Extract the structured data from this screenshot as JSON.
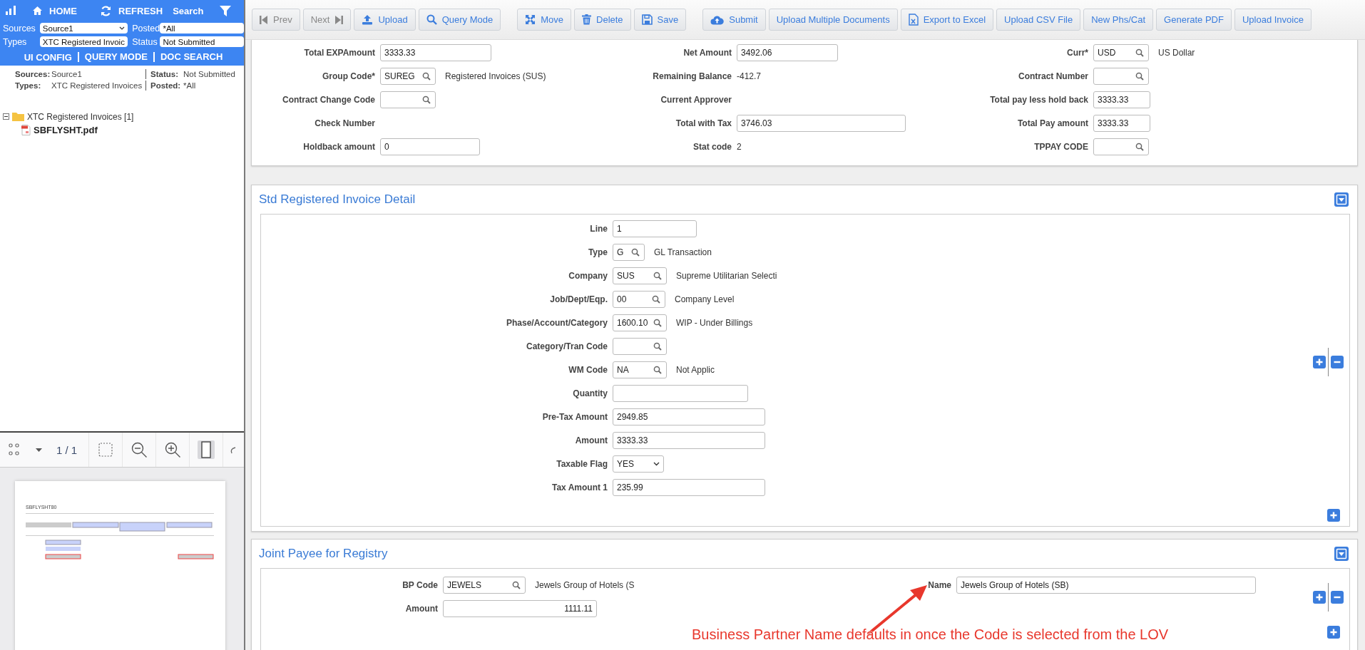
{
  "left_panel": {
    "topbar": {
      "home": "HOME",
      "refresh": "REFRESH",
      "search": "Search"
    },
    "filters": [
      {
        "label": "Sources",
        "kind": "select",
        "value": "Source1"
      },
      {
        "label": "Posted",
        "kind": "input",
        "value": "*All"
      },
      {
        "label": "Types",
        "kind": "select",
        "value": "XTC Registered Invoic"
      },
      {
        "label": "Status",
        "kind": "input",
        "value": "Not Submitted"
      }
    ],
    "links": [
      "UI CONFIG",
      "QUERY MODE",
      "DOC SEARCH"
    ],
    "summary": [
      {
        "label": "Sources:",
        "value": "Source1"
      },
      {
        "label": "Status:",
        "value": "Not Submitted"
      },
      {
        "label": "Types:",
        "value": "XTC Registered Invoices"
      },
      {
        "label": "Posted:",
        "value": "*All"
      }
    ],
    "tree": [
      {
        "label": "XTC Registered Invoices [1]",
        "expanded": true,
        "children": [
          {
            "label": "SBFLYSHT.pdf"
          }
        ]
      }
    ],
    "viewer": {
      "page_indicator": "1 / 1",
      "fit_page_active": true,
      "document_title": "SBFLYSHT80"
    }
  },
  "toolbar": {
    "groups": [
      {
        "buttons": [
          {
            "label": "Prev",
            "disabled": true
          },
          {
            "label": "Next",
            "disabled": true
          },
          {
            "label": "Upload",
            "disabled": false
          },
          {
            "label": "Query Mode",
            "disabled": false
          }
        ]
      },
      {
        "buttons": [
          {
            "label": "Move",
            "disabled": false
          },
          {
            "label": "Delete",
            "disabled": false
          },
          {
            "label": "Save",
            "disabled": false
          }
        ]
      },
      {
        "buttons": [
          {
            "label": "Submit",
            "disabled": false
          },
          {
            "label": "Upload Multiple Documents",
            "disabled": false
          },
          {
            "label": "Export to Excel",
            "disabled": false
          },
          {
            "label": "Upload CSV File",
            "disabled": false
          },
          {
            "label": "New Phs/Cat",
            "disabled": false
          },
          {
            "label": "Generate PDF",
            "disabled": false
          },
          {
            "label": "Upload Invoice",
            "disabled": false
          }
        ]
      }
    ]
  },
  "header_form": {
    "columns": [
      {
        "fields": [
          {
            "label": "Total EXPAmount",
            "kind": "input",
            "value": "3333.33"
          },
          {
            "label": "Group Code*",
            "kind": "lookup",
            "value": "SUREG",
            "description": "Registered Invoices (SUS)"
          },
          {
            "label": "Contract Change Code",
            "kind": "lookup"
          },
          {
            "label": "Check Number",
            "kind": "static"
          },
          {
            "label": "Holdback amount",
            "kind": "input",
            "value": "0"
          }
        ]
      },
      {
        "fields": [
          {
            "label": "Net Amount",
            "kind": "input",
            "value": "3492.06"
          },
          {
            "label": "Remaining Balance",
            "kind": "static",
            "value": "-412.7"
          },
          {
            "label": "Current Approver",
            "kind": "static"
          },
          {
            "label": "Total with Tax",
            "kind": "input",
            "value": "3746.03"
          },
          {
            "label": "Stat code",
            "kind": "static",
            "value": "2"
          }
        ]
      },
      {
        "fields": [
          {
            "label": "Curr*",
            "kind": "lookup",
            "value": "USD",
            "description": "US Dollar"
          },
          {
            "label": "Contract Number",
            "kind": "lookup"
          },
          {
            "label": "Total pay less hold back",
            "kind": "input",
            "value": "3333.33"
          },
          {
            "label": "Total Pay amount",
            "kind": "input",
            "value": "3333.33"
          },
          {
            "label": "TPPAY CODE",
            "kind": "lookup"
          }
        ]
      }
    ]
  },
  "detail_section": {
    "title": "Std Registered Invoice Detail",
    "fields": [
      {
        "label": "Line",
        "kind": "input",
        "value": "1"
      },
      {
        "label": "Type",
        "kind": "lookup",
        "value": "G",
        "description": "GL Transaction"
      },
      {
        "label": "Company",
        "kind": "lookup",
        "value": "SUS",
        "description": "Supreme Utilitarian Selecti"
      },
      {
        "label": "Job/Dept/Eqp.",
        "kind": "lookup",
        "value": "00",
        "description": "Company Level"
      },
      {
        "label": "Phase/Account/Category",
        "kind": "lookup",
        "value": "1600.10",
        "description": "WIP - Under Billings"
      },
      {
        "label": "Category/Tran Code",
        "kind": "lookup"
      },
      {
        "label": "WM Code",
        "kind": "lookup",
        "value": "NA",
        "description": "Not Applic"
      },
      {
        "label": "Quantity",
        "kind": "input"
      },
      {
        "label": "Pre-Tax Amount",
        "kind": "input",
        "value": "2949.85"
      },
      {
        "label": "Amount",
        "kind": "input",
        "value": "3333.33"
      },
      {
        "label": "Taxable Flag",
        "kind": "select",
        "value": "YES"
      },
      {
        "label": "Tax Amount 1",
        "kind": "input",
        "value": "235.99"
      }
    ]
  },
  "joint_payee": {
    "title": "Joint Payee for Registry",
    "fields": [
      {
        "label": "BP Code",
        "kind": "lookup",
        "value": "JEWELS",
        "description": "Jewels Group of Hotels (S"
      },
      {
        "label": "Name",
        "kind": "input",
        "value": "Jewels Group of Hotels (SB)"
      },
      {
        "label": "Amount",
        "kind": "amount",
        "value": "1111.11"
      }
    ]
  },
  "annotation": {
    "text": "Business Partner Name defaults in once the Code is selected from the LOV"
  }
}
